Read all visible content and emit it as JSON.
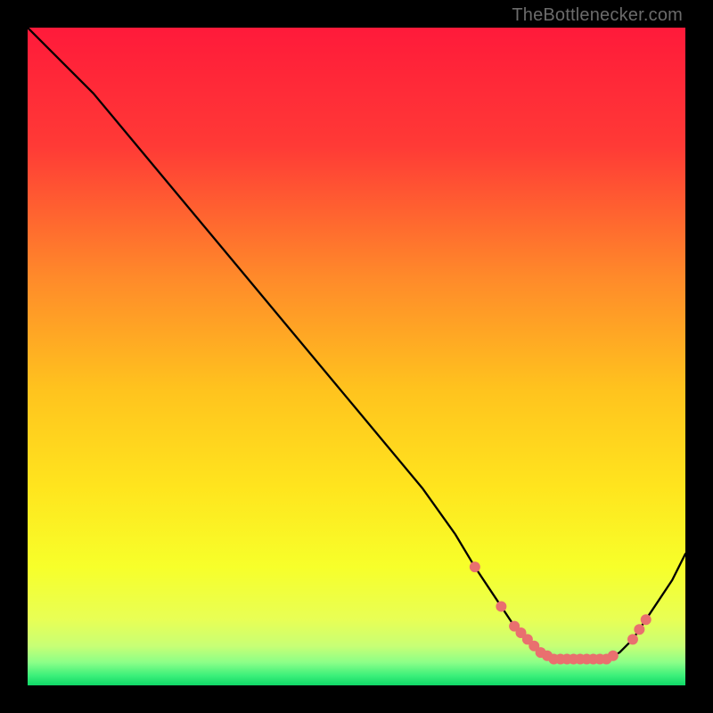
{
  "attribution": "TheBottlenecker.com",
  "colors": {
    "top": "#ff1a3a",
    "mid_upper": "#ff7a2e",
    "mid": "#ffd21e",
    "mid_lower": "#f8ff2a",
    "near_bottom": "#9cff77",
    "bottom": "#12e06a",
    "curve": "#000000",
    "marker": "#e9706f"
  },
  "chart_data": {
    "type": "line",
    "title": "",
    "xlabel": "",
    "ylabel": "",
    "xlim": [
      0,
      100
    ],
    "ylim": [
      0,
      100
    ],
    "grid": false,
    "series": [
      {
        "name": "bottleneck-curve",
        "x": [
          0,
          6,
          10,
          20,
          30,
          40,
          50,
          60,
          65,
          68,
          70,
          72,
          74,
          76,
          78,
          80,
          82,
          84,
          86,
          88,
          90,
          92,
          94,
          96,
          98,
          100
        ],
        "y": [
          100,
          94,
          90,
          78,
          66,
          54,
          42,
          30,
          23,
          18,
          15,
          12,
          9,
          7,
          5,
          4,
          4,
          4,
          4,
          4,
          5,
          7,
          10,
          13,
          16,
          20
        ]
      }
    ],
    "markers": {
      "name": "highlighted-points",
      "x": [
        68,
        72,
        74,
        75,
        76,
        77,
        78,
        79,
        80,
        81,
        82,
        83,
        84,
        85,
        86,
        87,
        88,
        89,
        92,
        93,
        94
      ],
      "y": [
        18,
        12,
        9,
        8,
        7,
        6,
        5,
        4.5,
        4,
        4,
        4,
        4,
        4,
        4,
        4,
        4,
        4,
        4.5,
        7,
        8.5,
        10
      ]
    }
  }
}
